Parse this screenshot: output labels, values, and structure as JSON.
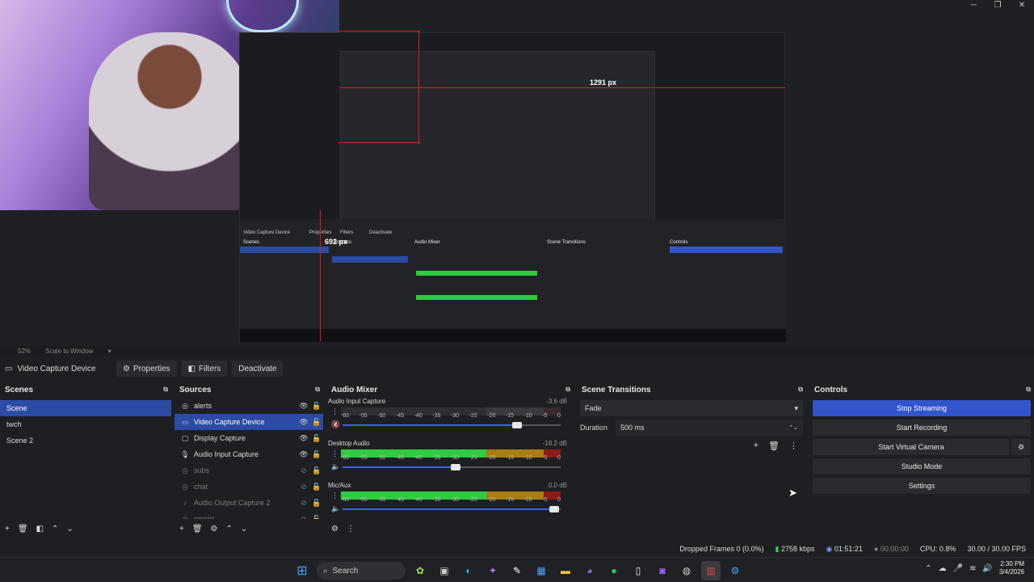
{
  "window": {
    "controls": [
      "─",
      "❐",
      "✕"
    ]
  },
  "preview": {
    "measure_h": "1291 px",
    "measure_v": "692 px",
    "zoom": "52%",
    "scale_mode": "Scale to Window",
    "nested": {
      "video_capture": "Video Capture Device",
      "properties": "Properties",
      "filters": "Filters",
      "deactivate": "Deactivate",
      "scenes_title": "Scenes",
      "sources_title": "Sources",
      "mixer_title": "Audio Mixer",
      "transitions_title": "Scene Transitions",
      "controls_title": "Controls"
    }
  },
  "context_bar": {
    "source_name": "Video Capture Device",
    "properties": "Properties",
    "filters": "Filters",
    "deactivate": "Deactivate"
  },
  "scenes": {
    "title": "Scenes",
    "items": [
      {
        "label": "Scene",
        "selected": true
      },
      {
        "label": "twch",
        "selected": false
      },
      {
        "label": "Scene 2",
        "selected": false
      }
    ]
  },
  "sources": {
    "title": "Sources",
    "items": [
      {
        "label": "alerts",
        "icon": "globe-icon",
        "visible": true
      },
      {
        "label": "Video Capture Device",
        "icon": "camera-icon",
        "visible": true,
        "selected": true
      },
      {
        "label": "Display Capture",
        "icon": "monitor-icon",
        "visible": true
      },
      {
        "label": "Audio Input Capture",
        "icon": "microphone-icon",
        "visible": true
      },
      {
        "label": "subs",
        "icon": "globe-icon",
        "visible": false
      },
      {
        "label": "chat",
        "icon": "globe-icon",
        "visible": false
      },
      {
        "label": "Audio Output Capture 2",
        "icon": "speaker-icon",
        "visible": false
      },
      {
        "label": "emojis",
        "icon": "globe-icon",
        "visible": false
      }
    ]
  },
  "mixer": {
    "title": "Audio Mixer",
    "ticks": [
      "-60",
      "-55",
      "-50",
      "-45",
      "-40",
      "-35",
      "-30",
      "-25",
      "-20",
      "-15",
      "-10",
      "-5",
      "0"
    ],
    "channels": [
      {
        "name": "Audio Input Capture",
        "db": "-3.6 dB",
        "level": 0.0,
        "volume": 0.8,
        "muted": true
      },
      {
        "name": "Desktop Audio",
        "db": "-16.2 dB",
        "level": 0.8,
        "volume": 0.52,
        "muted": false
      },
      {
        "name": "Mic/Aux",
        "db": "0.0 dB",
        "level": 0.68,
        "volume": 0.97,
        "muted": false
      }
    ]
  },
  "transitions": {
    "title": "Scene Transitions",
    "selected": "Fade",
    "duration_label": "Duration",
    "duration_value": "500 ms"
  },
  "controls": {
    "title": "Controls",
    "stop_streaming": "Stop Streaming",
    "start_recording": "Start Recording",
    "start_virtual_camera": "Start Virtual Camera",
    "studio_mode": "Studio Mode",
    "settings": "Settings"
  },
  "status": {
    "dropped_frames": "Dropped Frames 0 (0.0%)",
    "bitrate": "2758 kbps",
    "stream_time": "01:51:21",
    "rec_time": "00:00:00",
    "cpu": "CPU: 0.8%",
    "fps": "30.00 / 30.00 FPS"
  },
  "taskbar": {
    "search_label": "Search",
    "time": "2:30 PM",
    "date": "3/4/2026"
  },
  "colors": {
    "accent": "#2c4ba3",
    "button_active": "#3355cc",
    "meter_green": "#2ecc40",
    "meter_yellow": "#a87d14",
    "meter_red": "#8d1b1b"
  }
}
